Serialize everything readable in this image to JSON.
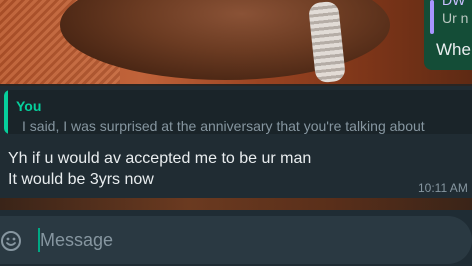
{
  "outgoing_peek": {
    "quote_top": "DW",
    "quote_text": "Ur n",
    "message_text": "Whe"
  },
  "incoming_message": {
    "reply": {
      "author": "You",
      "text": "I said, I was surprised at the anniversary that you're talking about"
    },
    "text": "Yh if u would av accepted me to be ur man\nIt would be 3yrs now",
    "time": "10:11 AM"
  },
  "composer": {
    "placeholder": "Message"
  },
  "colors": {
    "reply_accent": "#06cf9c",
    "bubble_incoming": "#202c33",
    "bubble_outgoing": "#144d37",
    "cursor": "#00a884"
  },
  "icons": {
    "emoji": "emoji-icon"
  }
}
